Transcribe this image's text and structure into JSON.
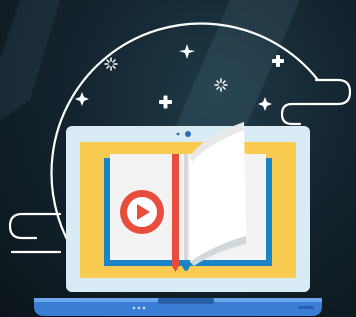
{
  "illustration": {
    "colors": {
      "background_dark": "#0b141a",
      "background_mid": "#1e3a48",
      "outline_white": "#ffffff",
      "screen_frame": "#d9ecf5",
      "screen_yellow": "#f9cb50",
      "book_blue": "#1a84c7",
      "book_page": "#f3f3f3",
      "bookmark_red": "#e74c3c",
      "play_red": "#e74c3c",
      "laptop_base": "#3a7fd5",
      "laptop_base_dark": "#2a5faa"
    },
    "icons": [
      "sparkle-icon",
      "plus-icon",
      "dotted-circle-icon",
      "play-icon",
      "book-icon",
      "laptop-icon",
      "webcam-icon"
    ]
  }
}
